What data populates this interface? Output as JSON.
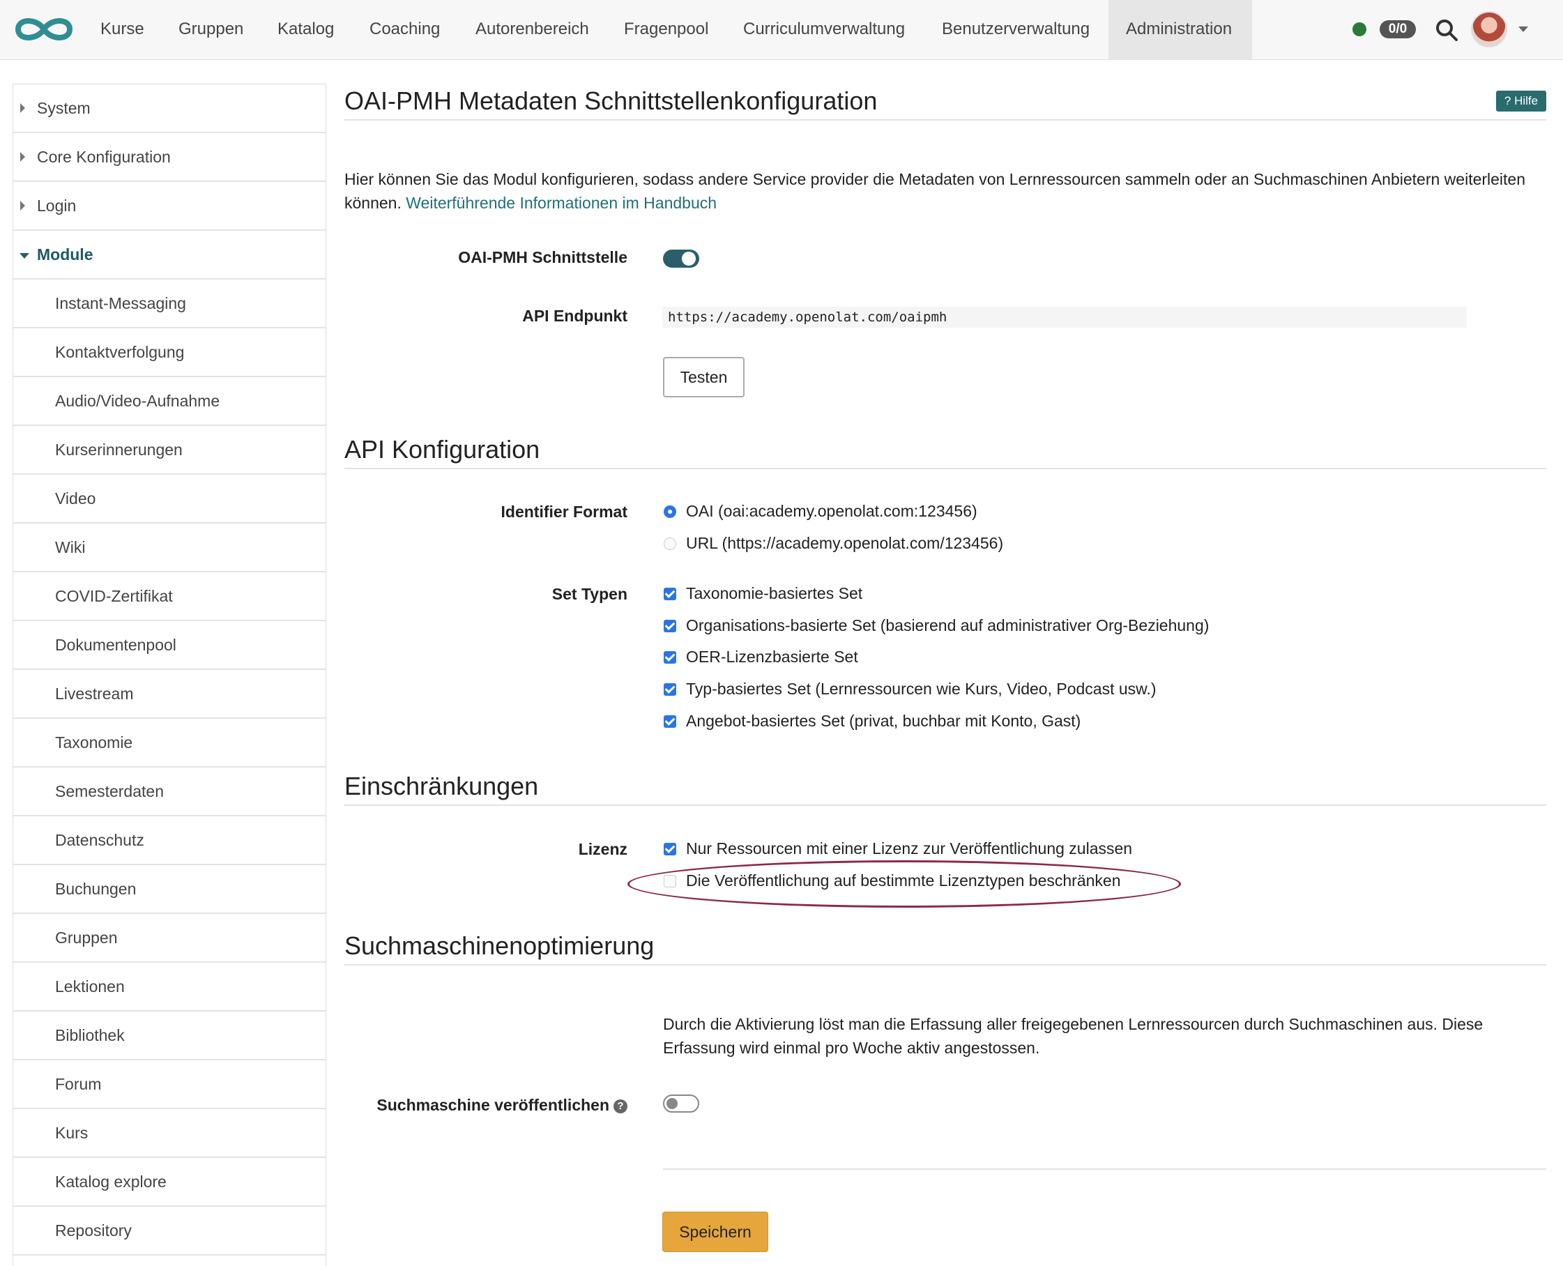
{
  "nav": {
    "items": [
      "Kurse",
      "Gruppen",
      "Katalog",
      "Coaching",
      "Autorenbereich",
      "Fragenpool",
      "Curriculumverwaltung",
      "Benutzerverwaltung",
      "Administration"
    ],
    "badge": "0/0"
  },
  "sidebar": {
    "items": [
      {
        "label": "System",
        "type": "collapsed"
      },
      {
        "label": "Core Konfiguration",
        "type": "collapsed"
      },
      {
        "label": "Login",
        "type": "collapsed"
      },
      {
        "label": "Module",
        "type": "expanded"
      },
      {
        "label": "Instant-Messaging",
        "type": "sub"
      },
      {
        "label": "Kontaktverfolgung",
        "type": "sub"
      },
      {
        "label": "Audio/Video-Aufnahme",
        "type": "sub"
      },
      {
        "label": "Kurserinnerungen",
        "type": "sub"
      },
      {
        "label": "Video",
        "type": "sub"
      },
      {
        "label": "Wiki",
        "type": "sub"
      },
      {
        "label": "COVID-Zertifikat",
        "type": "sub"
      },
      {
        "label": "Dokumentenpool",
        "type": "sub"
      },
      {
        "label": "Livestream",
        "type": "sub"
      },
      {
        "label": "Taxonomie",
        "type": "sub"
      },
      {
        "label": "Semesterdaten",
        "type": "sub"
      },
      {
        "label": "Datenschutz",
        "type": "sub"
      },
      {
        "label": "Buchungen",
        "type": "sub"
      },
      {
        "label": "Gruppen",
        "type": "sub"
      },
      {
        "label": "Lektionen",
        "type": "sub"
      },
      {
        "label": "Bibliothek",
        "type": "sub"
      },
      {
        "label": "Forum",
        "type": "sub"
      },
      {
        "label": "Kurs",
        "type": "sub"
      },
      {
        "label": "Katalog explore",
        "type": "sub"
      },
      {
        "label": "Repository",
        "type": "sub"
      }
    ]
  },
  "main": {
    "title": "OAI-PMH Metadaten Schnittstellenkonfiguration",
    "help": "Hilfe",
    "intro": "Hier können Sie das Modul konfigurieren, sodass andere Service provider die Metadaten von Lernressourcen sammeln oder an Suchmaschinen Anbietern weiterleiten können.",
    "intro_link": "Weiterführende Informationen im Handbuch",
    "interface_label": "OAI-PMH Schnittstelle",
    "endpoint_label": "API Endpunkt",
    "endpoint_value": "https://academy.openolat.com/oaipmh",
    "test_button": "Testen"
  },
  "api": {
    "heading": "API Konfiguration",
    "identifier_label": "Identifier Format",
    "identifier_options": [
      {
        "label": "OAI (oai:academy.openolat.com:123456)",
        "selected": true
      },
      {
        "label": "URL (https://academy.openolat.com/123456)",
        "selected": false
      }
    ],
    "set_label": "Set Typen",
    "set_options": [
      {
        "label": "Taxonomie-basiertes Set",
        "checked": true
      },
      {
        "label": "Organisations-basierte Set (basierend auf administrativer Org-Beziehung)",
        "checked": true
      },
      {
        "label": "OER-Lizenzbasierte Set",
        "checked": true
      },
      {
        "label": "Typ-basiertes Set (Lernressourcen wie Kurs, Video, Podcast usw.)",
        "checked": true
      },
      {
        "label": "Angebot-basiertes Set (privat, buchbar mit Konto, Gast)",
        "checked": true
      }
    ]
  },
  "restrictions": {
    "heading": "Einschränkungen",
    "license_label": "Lizenz",
    "options": [
      {
        "label": "Nur Ressourcen mit einer Lizenz zur Veröffentlichung zulassen",
        "checked": true
      },
      {
        "label": "Die Veröffentlichung auf bestimmte Lizenztypen beschränken",
        "checked": false
      }
    ]
  },
  "seo": {
    "heading": "Suchmaschinenoptimierung",
    "description": "Durch die Aktivierung löst man die Erfassung aller freigegebenen Lernressourcen durch Suchmaschinen aus. Diese Erfassung wird einmal pro Woche aktiv angestossen.",
    "publish_label": "Suchmaschine veröffentlichen",
    "save_button": "Speichern"
  },
  "colors": {
    "brand": "#2a5f6a",
    "accent_blue": "#2b74e4",
    "save": "#e6a63c",
    "annotation": "#8b2a4d"
  }
}
